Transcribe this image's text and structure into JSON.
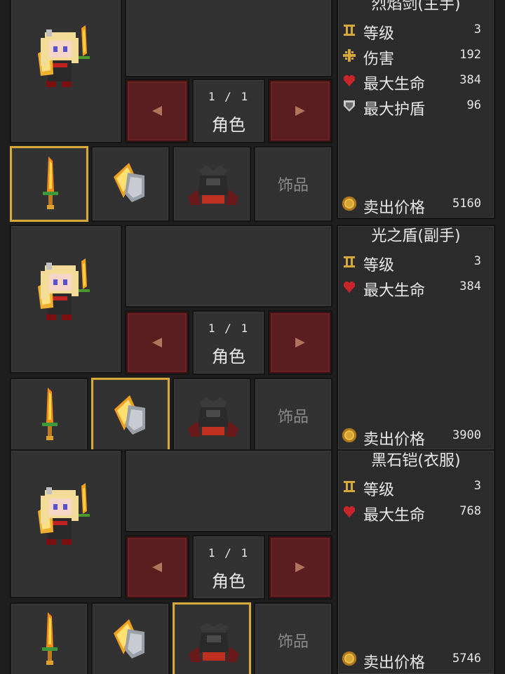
{
  "panels": [
    {
      "item_title": "烈焰剑(主手)",
      "pager": {
        "count": "1 / 1",
        "label": "角色"
      },
      "selected_slot": 0,
      "slots": {
        "accessory_label": "饰品"
      },
      "stats": [
        {
          "icon": "level-icon",
          "name": "等级",
          "value": "3"
        },
        {
          "icon": "damage-icon",
          "name": "伤害",
          "value": "192"
        },
        {
          "icon": "heart-icon",
          "name": "最大生命",
          "value": "384"
        },
        {
          "icon": "shield-icon",
          "name": "最大护盾",
          "value": "96"
        }
      ],
      "sell": {
        "label": "卖出价格",
        "value": "5160"
      }
    },
    {
      "item_title": "光之盾(副手)",
      "pager": {
        "count": "1 / 1",
        "label": "角色"
      },
      "selected_slot": 1,
      "slots": {
        "accessory_label": "饰品"
      },
      "stats": [
        {
          "icon": "level-icon",
          "name": "等级",
          "value": "3"
        },
        {
          "icon": "heart-icon",
          "name": "最大生命",
          "value": "384"
        }
      ],
      "sell": {
        "label": "卖出价格",
        "value": "3900"
      }
    },
    {
      "item_title": "黑石铠(衣服)",
      "pager": {
        "count": "1 / 1",
        "label": "角色"
      },
      "selected_slot": 2,
      "slots": {
        "accessory_label": "饰品"
      },
      "stats": [
        {
          "icon": "level-icon",
          "name": "等级",
          "value": "3"
        },
        {
          "icon": "heart-icon",
          "name": "最大生命",
          "value": "768"
        }
      ],
      "sell": {
        "label": "卖出价格",
        "value": "5746"
      }
    }
  ],
  "colors": {
    "frame": "#141414",
    "box": "#323232",
    "arrow_red": "#5a1e20",
    "selected_gold": "#d6a93a",
    "heart": "#c8262b",
    "coin": "#d9a532"
  }
}
